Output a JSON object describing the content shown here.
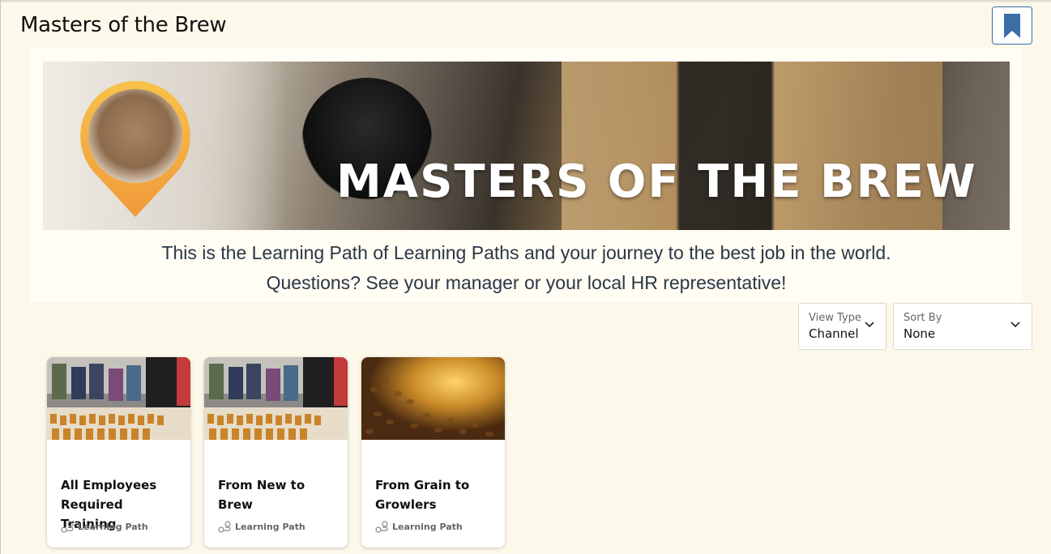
{
  "header": {
    "title": "Masters of the Brew",
    "bookmark_icon": "bookmark-icon"
  },
  "banner": {
    "hero_title": "MASTERS OF THE BREW",
    "description_line1": "This is the Learning Path of Learning Paths and your journey to the best job in the world.",
    "description_line2": "Questions? See your manager or your local HR representative!"
  },
  "controls": {
    "view_type": {
      "label": "View Type",
      "value": "Channel"
    },
    "sort_by": {
      "label": "Sort By",
      "value": "None"
    }
  },
  "cards": [
    {
      "title": "All Employees Required Training",
      "type": "Learning Path",
      "icon": "learning-path-icon"
    },
    {
      "title": "From New to Brew",
      "type": "Learning Path",
      "icon": "learning-path-icon"
    },
    {
      "title": "From Grain to Growlers",
      "type": "Learning Path",
      "icon": "learning-path-icon"
    }
  ],
  "colors": {
    "background": "#fdf9ea",
    "accent": "#3a6fa5",
    "text": "#2c3645"
  }
}
